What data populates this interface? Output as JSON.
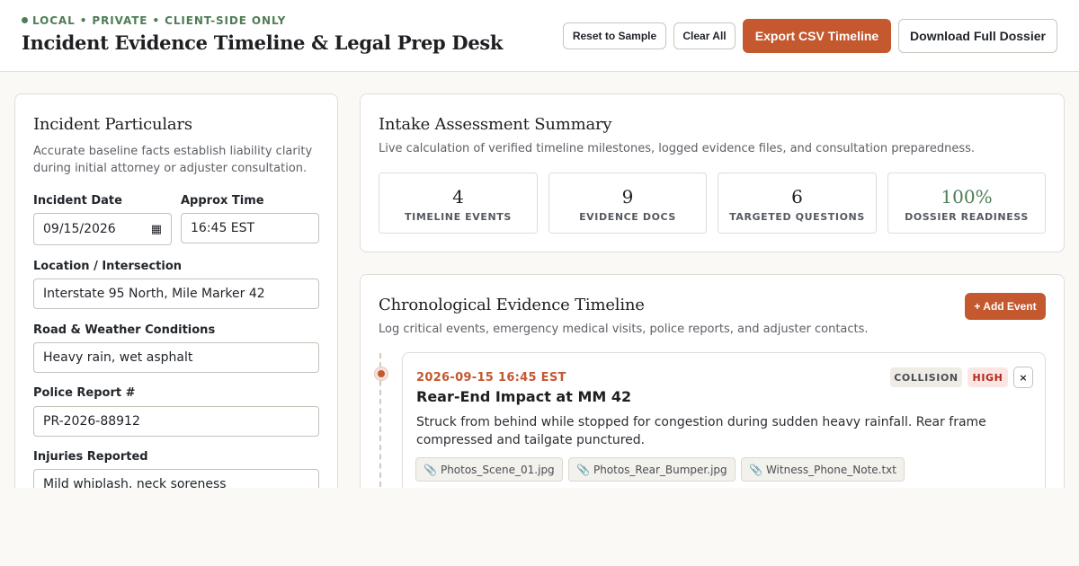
{
  "header": {
    "eyebrow": "LOCAL • PRIVATE • CLIENT-SIDE ONLY",
    "title": "Incident Evidence Timeline & Legal Prep Desk",
    "buttons": {
      "reset": "Reset to Sample",
      "clear": "Clear All",
      "export": "Export CSV Timeline",
      "dossier": "Download Full Dossier"
    }
  },
  "particulars": {
    "title": "Incident Particulars",
    "description": "Accurate baseline facts establish liability clarity during initial attorney or adjuster consultation.",
    "fields": {
      "date": {
        "label": "Incident Date",
        "value": "09/15/2026"
      },
      "time": {
        "label": "Approx Time",
        "value": "16:45 EST"
      },
      "location": {
        "label": "Location / Intersection",
        "value": "Interstate 95 North, Mile Marker 42"
      },
      "conditions": {
        "label": "Road & Weather Conditions",
        "value": "Heavy rain, wet asphalt"
      },
      "police": {
        "label": "Police Report #",
        "value": "PR-2026-88912"
      },
      "injuries": {
        "label": "Injuries Reported",
        "value": "Mild whiplash, neck soreness"
      }
    }
  },
  "summary": {
    "title": "Intake Assessment Summary",
    "description": "Live calculation of verified timeline milestones, logged evidence files, and consultation preparedness.",
    "stats": [
      {
        "value": "4",
        "label": "TIMELINE EVENTS"
      },
      {
        "value": "9",
        "label": "EVIDENCE DOCS"
      },
      {
        "value": "6",
        "label": "TARGETED QUESTIONS"
      },
      {
        "value": "100%",
        "label": "DOSSIER READINESS"
      }
    ],
    "accent_color": "#4f7d56"
  },
  "timeline": {
    "title": "Chronological Evidence Timeline",
    "description": "Log critical events, emergency medical visits, police reports, and adjuster contacts.",
    "add_label": "+ Add Event",
    "events": [
      {
        "datetime": "2026-09-15 16:45 EST",
        "title": "Rear-End Impact at MM 42",
        "description": "Struck from behind while stopped for congestion during sudden heavy rainfall. Rear frame compressed and tailgate punctured.",
        "type": "COLLISION",
        "severity": "HIGH",
        "close_label": "×",
        "attachments": [
          "Photos_Scene_01.jpg",
          "Photos_Rear_Bumper.jpg",
          "Witness_Phone_Note.txt"
        ]
      }
    ]
  },
  "colors": {
    "primary": "#c4582f",
    "success": "#4f7d56",
    "danger": "#b3261e"
  }
}
